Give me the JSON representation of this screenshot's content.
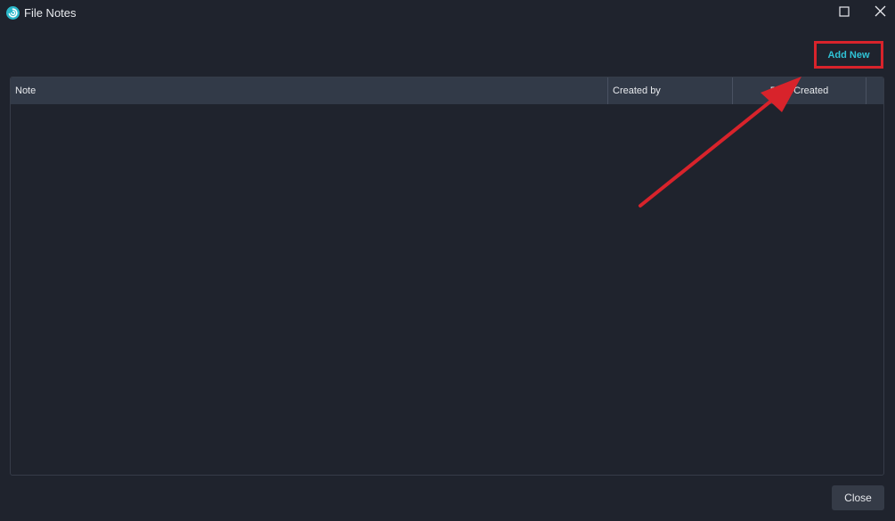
{
  "window": {
    "title": "File Notes",
    "app_icon": "app-logo-icon",
    "maximize_icon": "maximize-icon",
    "close_icon": "close-icon"
  },
  "toolbar": {
    "add_new_label": "Add New"
  },
  "table": {
    "columns": [
      "Note",
      "Created by",
      "Date Created",
      ""
    ],
    "rows": []
  },
  "footer": {
    "close_label": "Close"
  },
  "colors": {
    "background": "#1f232d",
    "header": "#323a48",
    "accent": "#2fc3d6",
    "annotation": "#d8232b"
  }
}
